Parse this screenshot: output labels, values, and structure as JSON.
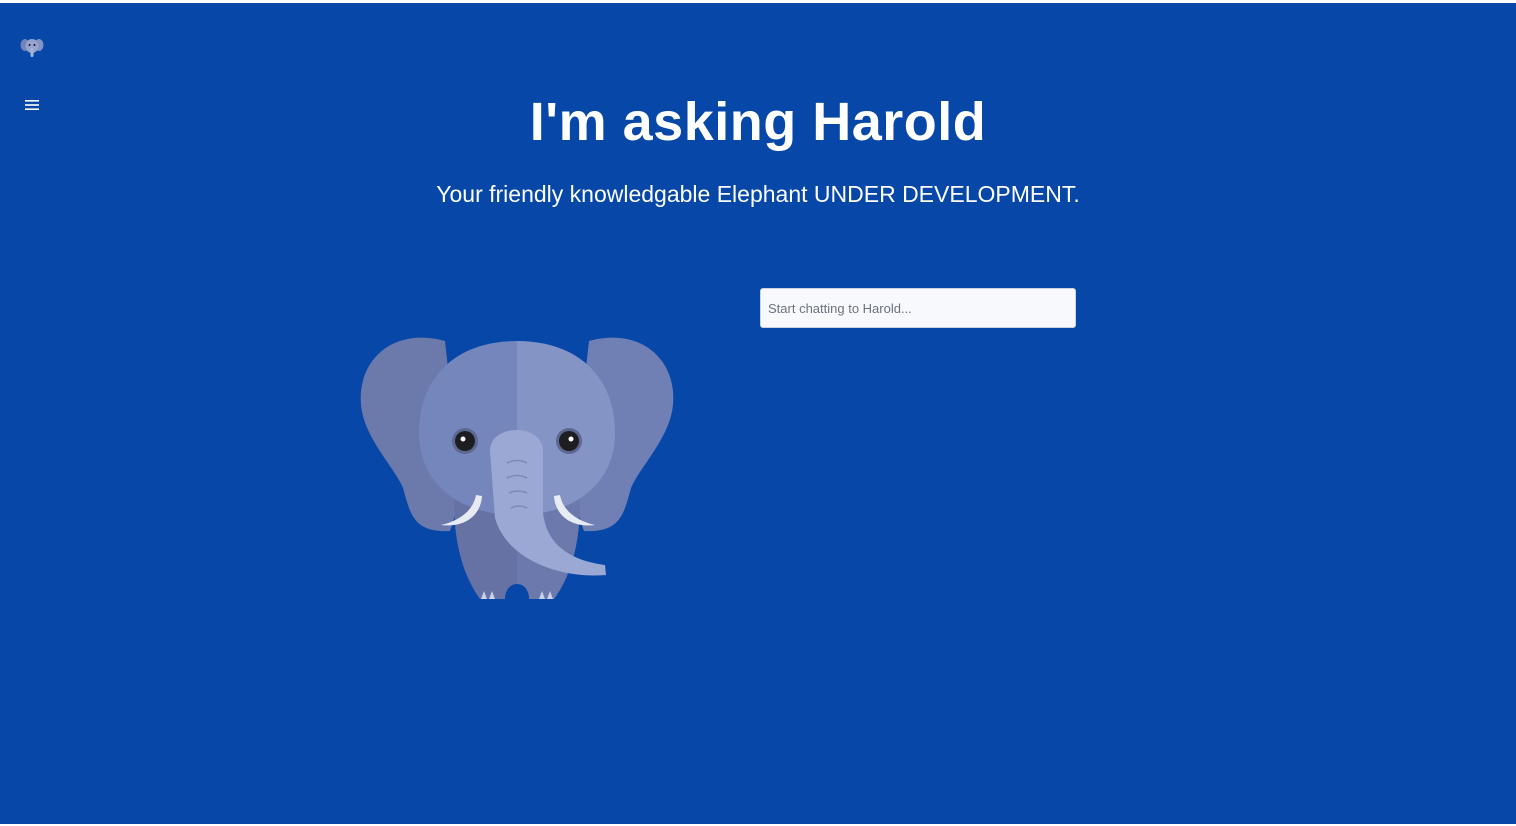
{
  "sidebar": {
    "logo_icon": "elephant-logo-icon",
    "menu_icon": "hamburger-menu-icon"
  },
  "hero": {
    "title": "I'm asking Harold",
    "subtitle": "Your friendly knowledgable Elephant UNDER DEVELOPMENT."
  },
  "illustration": {
    "icon": "elephant-illustration"
  },
  "chat": {
    "placeholder": "Start chatting to Harold...",
    "value": ""
  },
  "colors": {
    "background": "#0647a8",
    "text": "#ffffff",
    "elephant_body": "#7283b8",
    "elephant_tusk": "#e8ebf3"
  }
}
